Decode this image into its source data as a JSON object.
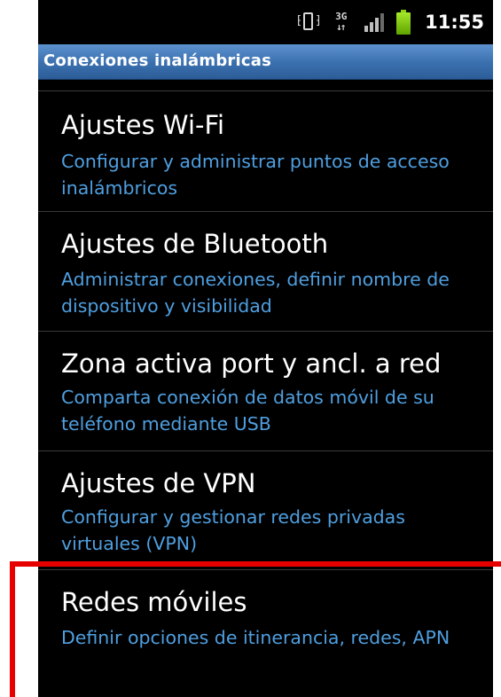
{
  "status_bar": {
    "time": "11:55",
    "icons": [
      "vibrate-icon",
      "3g-data-icon",
      "signal-icon",
      "battery-icon"
    ],
    "network_label": "3G",
    "colors": {
      "battery": "#8cd40c",
      "text": "#ffffff"
    }
  },
  "title_bar": {
    "title": "Conexiones inalámbricas",
    "colors": {
      "background": "#3a6fae"
    }
  },
  "settings_list": {
    "items": [
      {
        "title": "Ajustes Wi-Fi",
        "summary": "Configurar y administrar puntos de acceso inalámbricos"
      },
      {
        "title": "Ajustes de Bluetooth",
        "summary": "Administrar conexiones, definir nombre de dispositivo y visibilidad"
      },
      {
        "title": "Zona activa port y ancl. a red",
        "summary": "Comparta conexión de datos móvil de su teléfono mediante USB"
      },
      {
        "title": "Ajustes de VPN",
        "summary": "Configurar y gestionar redes privadas virtuales (VPN)"
      },
      {
        "title": "Redes móviles",
        "summary": "Definir opciones de itinerancia, redes, APN"
      }
    ],
    "colors": {
      "title": "#ffffff",
      "summary": "#4f9fe0",
      "background": "#000000"
    }
  },
  "highlight": {
    "target": "Redes móviles",
    "color": "#e60000"
  }
}
